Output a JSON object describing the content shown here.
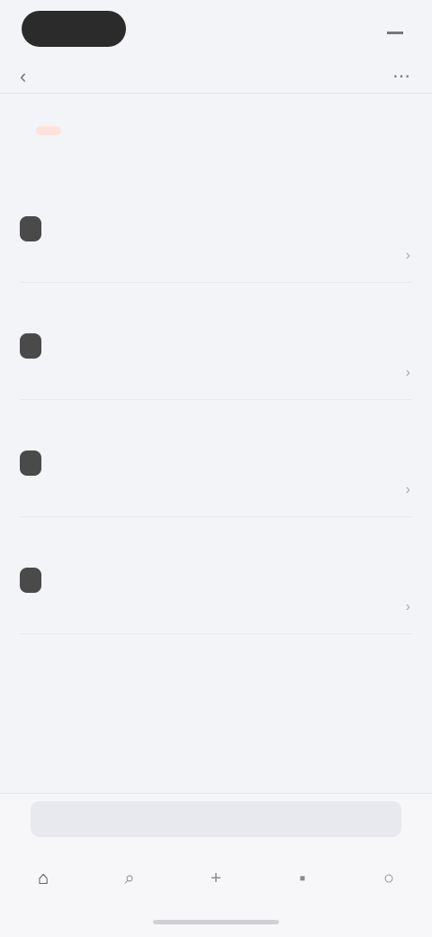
{
  "status_bar": {
    "time": "",
    "battery": ""
  },
  "nav": {
    "title": ""
  },
  "header": {
    "title": "",
    "badge": "",
    "price": "",
    "description": ""
  },
  "items": [
    {
      "name": "",
      "price": "",
      "tag": ""
    },
    {
      "name": "",
      "price": "",
      "tag": ""
    },
    {
      "name": "",
      "price": "",
      "tag": ""
    },
    {
      "name": "",
      "price": "",
      "tag": ""
    },
    {
      "name": "",
      "price": ""
    }
  ],
  "action_bar": {
    "label": ""
  },
  "tabs": [
    {
      "icon": "home-icon"
    },
    {
      "icon": "search-icon"
    },
    {
      "icon": "plus-icon"
    },
    {
      "icon": "chat-icon"
    },
    {
      "icon": "profile-icon"
    }
  ],
  "colors": {
    "accent": "#e8633a",
    "badge_bg": "#fde3d9",
    "tag_bg": "#4a4a4a",
    "background": "#f3f4f7"
  }
}
